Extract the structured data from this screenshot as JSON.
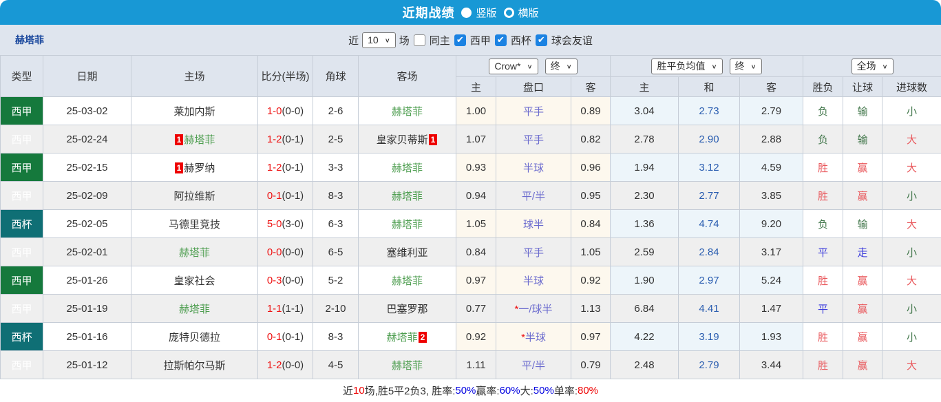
{
  "topbar": {
    "title": "近期战绩",
    "radios": [
      {
        "label": "竖版",
        "selected": true
      },
      {
        "label": "横版",
        "selected": false
      }
    ]
  },
  "filter": {
    "team": "赫塔菲",
    "near_label": "近",
    "games_select_value": "10",
    "games_unit_label": "场",
    "same_home": {
      "label": "同主",
      "checked": false
    },
    "leagues": [
      {
        "label": "西甲",
        "checked": true
      },
      {
        "label": "西杯",
        "checked": true
      },
      {
        "label": "球会友谊",
        "checked": true
      }
    ]
  },
  "table": {
    "headers": {
      "type": "类型",
      "date": "日期",
      "home": "主场",
      "score": "比分(半场)",
      "corner": "角球",
      "away": "客场",
      "odds_company_select": "Crow*",
      "odds_state_select": "终",
      "avg_company_select": "胜平负均值",
      "avg_state_select": "终",
      "scope_select": "全场",
      "sub": [
        "主",
        "盘口",
        "客",
        "主",
        "和",
        "客",
        "胜负",
        "让球",
        "进球数"
      ]
    },
    "rows": [
      {
        "type": "西甲",
        "date": "25-03-02",
        "home": {
          "name": "莱加内斯",
          "subject": false
        },
        "score_ft": "1-0",
        "score_ht": "0-0",
        "corners": "2-6",
        "away": {
          "name": "赫塔菲",
          "subject": true
        },
        "odds_home": "1.00",
        "handicap": "平手",
        "odds_away": "0.89",
        "avg_home": "3.04",
        "avg_draw": "2.73",
        "avg_away": "2.79",
        "result": "负",
        "handicap_result": "输",
        "goals": "小"
      },
      {
        "type": "西甲",
        "date": "25-02-24",
        "home": {
          "name": "赫塔菲",
          "subject": true,
          "red_card_before": "1"
        },
        "score_ft": "1-2",
        "score_ht": "0-1",
        "corners": "2-5",
        "away": {
          "name": "皇家贝蒂斯",
          "subject": false,
          "red_card_after": "1"
        },
        "odds_home": "1.07",
        "handicap": "平手",
        "odds_away": "0.82",
        "avg_home": "2.78",
        "avg_draw": "2.90",
        "avg_away": "2.88",
        "result": "负",
        "handicap_result": "输",
        "goals": "大"
      },
      {
        "type": "西甲",
        "date": "25-02-15",
        "home": {
          "name": "赫罗纳",
          "subject": false,
          "red_card_before": "1"
        },
        "score_ft": "1-2",
        "score_ht": "0-1",
        "corners": "3-3",
        "away": {
          "name": "赫塔菲",
          "subject": true
        },
        "odds_home": "0.93",
        "handicap": "半球",
        "odds_away": "0.96",
        "avg_home": "1.94",
        "avg_draw": "3.12",
        "avg_away": "4.59",
        "result": "胜",
        "handicap_result": "赢",
        "goals": "大"
      },
      {
        "type": "西甲",
        "date": "25-02-09",
        "home": {
          "name": "阿拉维斯",
          "subject": false
        },
        "score_ft": "0-1",
        "score_ht": "0-1",
        "corners": "8-3",
        "away": {
          "name": "赫塔菲",
          "subject": true
        },
        "odds_home": "0.94",
        "handicap": "平/半",
        "odds_away": "0.95",
        "avg_home": "2.30",
        "avg_draw": "2.77",
        "avg_away": "3.85",
        "result": "胜",
        "handicap_result": "赢",
        "goals": "小"
      },
      {
        "type": "西杯",
        "date": "25-02-05",
        "home": {
          "name": "马德里竞技",
          "subject": false
        },
        "score_ft": "5-0",
        "score_ht": "3-0",
        "corners": "6-3",
        "away": {
          "name": "赫塔菲",
          "subject": true
        },
        "odds_home": "1.05",
        "handicap": "球半",
        "odds_away": "0.84",
        "avg_home": "1.36",
        "avg_draw": "4.74",
        "avg_away": "9.20",
        "result": "负",
        "handicap_result": "输",
        "goals": "大"
      },
      {
        "type": "西甲",
        "date": "25-02-01",
        "home": {
          "name": "赫塔菲",
          "subject": true
        },
        "score_ft": "0-0",
        "score_ht": "0-0",
        "corners": "6-5",
        "away": {
          "name": "塞维利亚",
          "subject": false
        },
        "odds_home": "0.84",
        "handicap": "平手",
        "odds_away": "1.05",
        "avg_home": "2.59",
        "avg_draw": "2.84",
        "avg_away": "3.17",
        "result": "平",
        "handicap_result": "走",
        "goals": "小"
      },
      {
        "type": "西甲",
        "date": "25-01-26",
        "home": {
          "name": "皇家社会",
          "subject": false
        },
        "score_ft": "0-3",
        "score_ht": "0-0",
        "corners": "5-2",
        "away": {
          "name": "赫塔菲",
          "subject": true
        },
        "odds_home": "0.97",
        "handicap": "半球",
        "odds_away": "0.92",
        "avg_home": "1.90",
        "avg_draw": "2.97",
        "avg_away": "5.24",
        "result": "胜",
        "handicap_result": "赢",
        "goals": "大"
      },
      {
        "type": "西甲",
        "date": "25-01-19",
        "home": {
          "name": "赫塔菲",
          "subject": true
        },
        "score_ft": "1-1",
        "score_ht": "1-1",
        "corners": "2-10",
        "away": {
          "name": "巴塞罗那",
          "subject": false
        },
        "odds_home": "0.77",
        "handicap": "*一/球半",
        "odds_away": "1.13",
        "avg_home": "6.84",
        "avg_draw": "4.41",
        "avg_away": "1.47",
        "result": "平",
        "handicap_result": "赢",
        "goals": "小"
      },
      {
        "type": "西杯",
        "date": "25-01-16",
        "home": {
          "name": "庞特贝德拉",
          "subject": false
        },
        "score_ft": "0-1",
        "score_ht": "0-1",
        "corners": "8-3",
        "away": {
          "name": "赫塔菲",
          "subject": true,
          "red_card_after": "2"
        },
        "odds_home": "0.92",
        "handicap": "*半球",
        "odds_away": "0.97",
        "avg_home": "4.22",
        "avg_draw": "3.19",
        "avg_away": "1.93",
        "result": "胜",
        "handicap_result": "赢",
        "goals": "小"
      },
      {
        "type": "西甲",
        "date": "25-01-12",
        "home": {
          "name": "拉斯帕尔马斯",
          "subject": false
        },
        "score_ft": "1-2",
        "score_ht": "0-0",
        "corners": "4-5",
        "away": {
          "name": "赫塔菲",
          "subject": true
        },
        "odds_home": "1.11",
        "handicap": "平/半",
        "odds_away": "0.79",
        "avg_home": "2.48",
        "avg_draw": "2.79",
        "avg_away": "3.44",
        "result": "胜",
        "handicap_result": "赢",
        "goals": "大"
      }
    ]
  },
  "footer": {
    "segments": [
      {
        "text": "近",
        "color": "dark"
      },
      {
        "text": "10",
        "color": "red"
      },
      {
        "text": "场,胜5平2负3, 胜率:",
        "color": "dark"
      },
      {
        "text": "50%",
        "color": "blue"
      },
      {
        "text": " 赢率:",
        "color": "dark"
      },
      {
        "text": "60%",
        "color": "blue"
      },
      {
        "text": " 大:",
        "color": "dark"
      },
      {
        "text": "50%",
        "color": "blue"
      },
      {
        "text": " 单率:",
        "color": "dark"
      },
      {
        "text": "80%",
        "color": "red"
      }
    ]
  },
  "colors": {
    "topbar_blue": "#1898d5",
    "panel_gray_blue": "#dfe5ee",
    "league_green": "#15793c",
    "cup_teal": "#0f6f75",
    "stripe_gray": "#efefef",
    "handicap_col_bg": "#fdf8ee",
    "avg_col_bg": "#edf5fa",
    "score_red": "#ee1111",
    "subject_team_green": "#4e9e50",
    "handicap_text": "#6a6ace",
    "draw_avg_blue": "#2a5db0",
    "win_red": "#e9585c",
    "lose_green": "#42774b",
    "draw_blue": "#3c3cdc",
    "checkbox_blue": "#1b82e2"
  }
}
